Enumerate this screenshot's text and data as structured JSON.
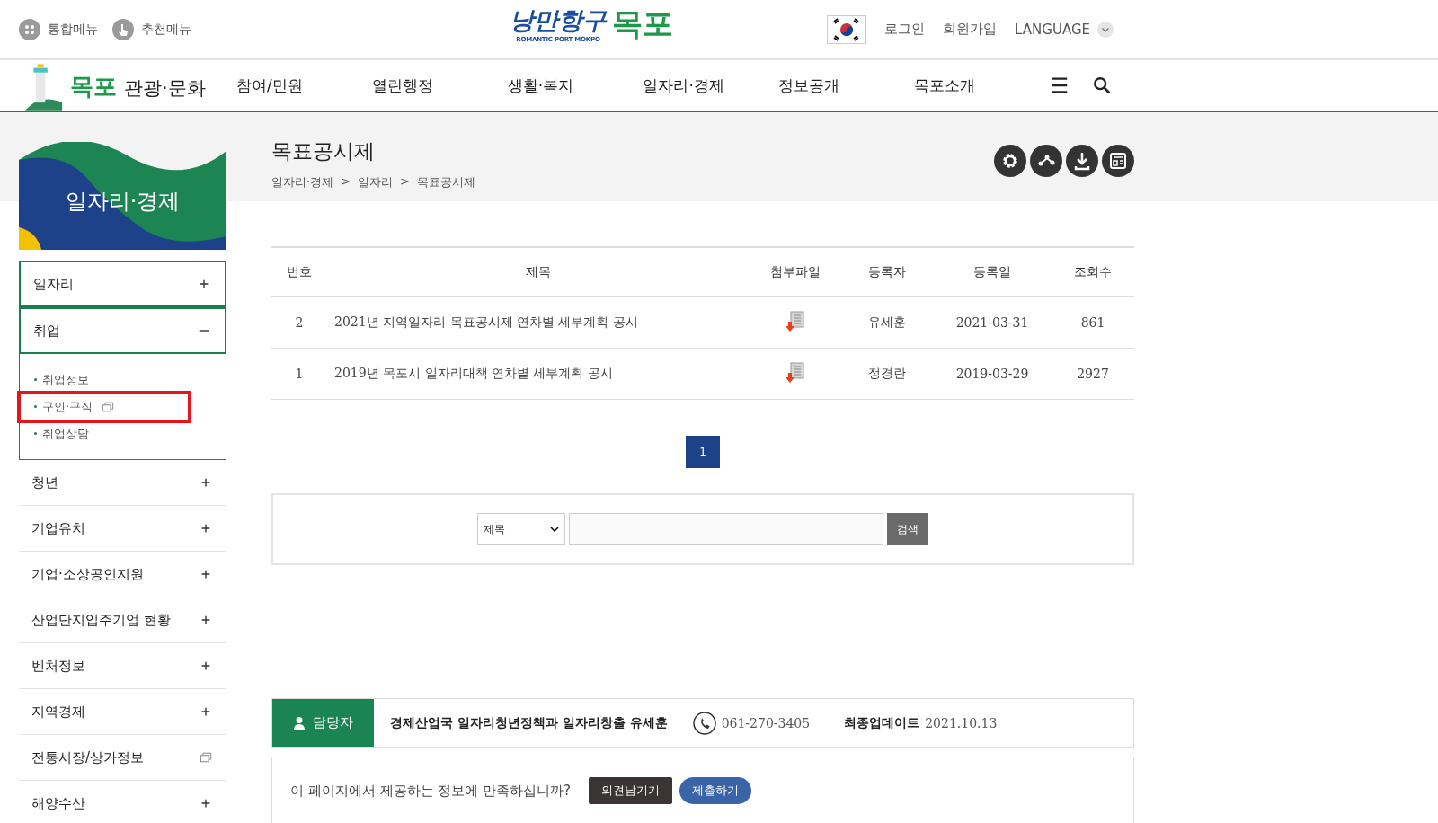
{
  "top_bar": {
    "menus": [
      {
        "label": "통합메뉴",
        "kind": "all"
      },
      {
        "label": "추천메뉴",
        "kind": "recommend"
      }
    ],
    "logo": {
      "slogan": "낭만항구",
      "city": "목포",
      "subtitle": "ROMANTIC PORT MOKPO"
    },
    "user_links": [
      "로그인",
      "회원가입"
    ],
    "language": "LANGUAGE"
  },
  "nav": {
    "logo": {
      "city": "목포",
      "text": "관광·문화"
    },
    "items": [
      "참여/민원",
      "열린행정",
      "생활·복지",
      "일자리·경제",
      "정보공개",
      "목포소개"
    ]
  },
  "sidebar": {
    "banner_title": "일자리·경제",
    "items": [
      {
        "label": "일자리",
        "kind": "toggle",
        "selected": true,
        "expanded": false
      },
      {
        "label": "취업",
        "kind": "toggle",
        "selected": true,
        "expanded": true,
        "children": [
          {
            "label": "취업정보",
            "external": false,
            "highlighted": false
          },
          {
            "label": "구인·구직",
            "external": true,
            "highlighted": true
          },
          {
            "label": "취업상담",
            "external": false,
            "highlighted": false
          }
        ]
      },
      {
        "label": "청년",
        "kind": "toggle",
        "selected": false,
        "expanded": false
      },
      {
        "label": "기업유치",
        "kind": "toggle",
        "selected": false,
        "expanded": false
      },
      {
        "label": "기업·소상공인지원",
        "kind": "toggle",
        "selected": false,
        "expanded": false
      },
      {
        "label": "산업단지입주기업 현황",
        "kind": "toggle",
        "selected": false,
        "expanded": false
      },
      {
        "label": "벤처정보",
        "kind": "toggle",
        "selected": false,
        "expanded": false
      },
      {
        "label": "지역경제",
        "kind": "toggle",
        "selected": false,
        "expanded": false
      },
      {
        "label": "전통시장/상가정보",
        "kind": "external",
        "selected": false
      },
      {
        "label": "해양수산",
        "kind": "toggle",
        "selected": false,
        "expanded": false
      }
    ]
  },
  "page": {
    "title": "목표공시제",
    "breadcrumb": [
      "일자리·경제",
      "일자리",
      "목표공시제"
    ],
    "separator": ">"
  },
  "table": {
    "columns": [
      "번호",
      "제목",
      "첨부파일",
      "등록자",
      "등록일",
      "조회수"
    ],
    "rows": [
      {
        "number": "2",
        "title": "2021년 지역일자리 목표공시제 연차별 세부계획 공시",
        "attachment": true,
        "author": "유세훈",
        "date": "2021-03-31",
        "views": "861"
      },
      {
        "number": "1",
        "title": "2019년 목포시 일자리대책 연차별 세부계획 공시",
        "attachment": true,
        "author": "정경란",
        "date": "2019-03-29",
        "views": "2927"
      }
    ]
  },
  "pagination": [
    {
      "label": "1",
      "selected": true
    }
  ],
  "search": {
    "field": "제목",
    "button": "검색"
  },
  "contact": {
    "label": "담당자",
    "person": "경제산업국 일자리청년정책과 일자리창출 유세훈",
    "phone": "061-270-3405",
    "update_label": "최종업데이트",
    "update_date": "2021.10.13"
  },
  "survey": {
    "question": "이 페이지에서 제공하는 정보에 만족하십니까?",
    "buttons": [
      {
        "label": "의견남기기",
        "kind": "dark"
      },
      {
        "label": "제출하기",
        "kind": "primary"
      }
    ]
  }
}
